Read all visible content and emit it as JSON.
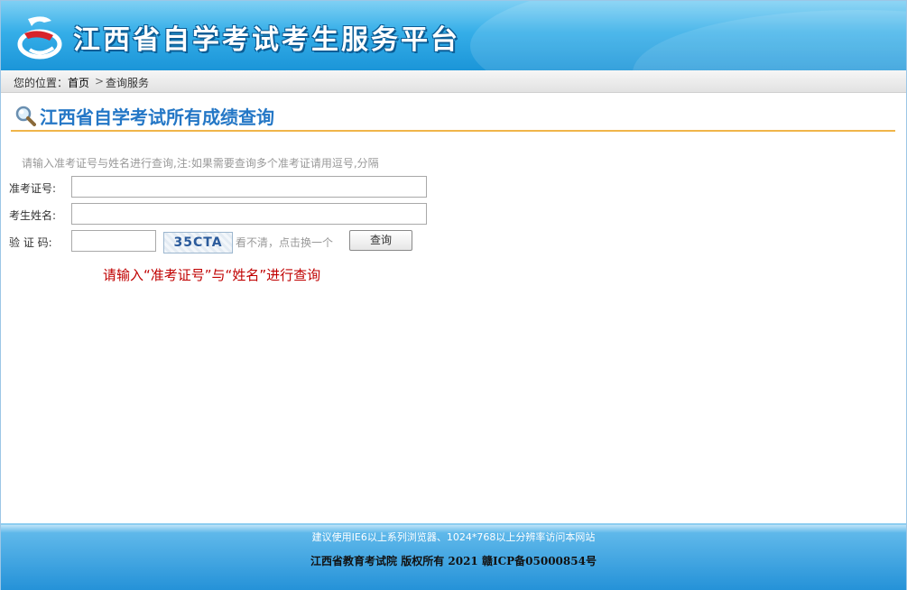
{
  "header": {
    "site_title": "江西省自学考试考生服务平台"
  },
  "breadcrumb": {
    "prefix": "您的位置：",
    "home": "首页",
    "separator": ">",
    "current": "查询服务"
  },
  "page": {
    "title": "江西省自学考试所有成绩查询"
  },
  "form": {
    "hint": "请输入准考证号与姓名进行查询,注:如果需要查询多个准考证请用逗号,分隔",
    "exam_id_label": "准考证号:",
    "exam_id_value": "",
    "name_label": "考生姓名:",
    "name_value": "",
    "captcha_label": "验 证 码:",
    "captcha_value": "",
    "captcha_text": "35CTA",
    "refresh_text": "看不清，点击换一个",
    "submit_label": "查询"
  },
  "message": {
    "text": "请输入“准考证号”与“姓名”进行查询"
  },
  "footer": {
    "line1": "建议使用IE6以上系列浏览器、1024*768以上分辨率访问本网站",
    "line2": "江西省教育考试院 版权所有 2021 赣ICP备05000854号"
  },
  "colors": {
    "brand_blue": "#2477c6",
    "accent_orange": "#f0b54a",
    "error_red": "#c00000"
  },
  "icons": {
    "logo": "site-logo-icon",
    "search": "magnifier-icon"
  }
}
